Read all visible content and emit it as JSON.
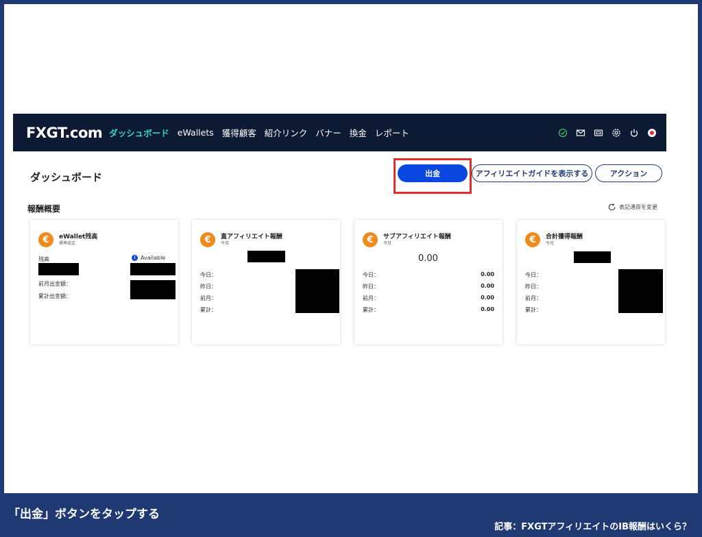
{
  "nav": {
    "logo": "FXGT.com",
    "items": [
      {
        "label": "ダッシュボード",
        "active": true
      },
      {
        "label": "eWallets",
        "active": false
      },
      {
        "label": "獲得顧客",
        "active": false
      },
      {
        "label": "紹介リンク",
        "active": false
      },
      {
        "label": "バナー",
        "active": false
      },
      {
        "label": "換金",
        "active": false
      },
      {
        "label": "レポート",
        "active": false
      }
    ],
    "icons": [
      "verified-icon",
      "mail-icon",
      "ticket-icon",
      "gear-icon",
      "power-icon",
      "flag-icon"
    ]
  },
  "page": {
    "title": "ダッシュボード",
    "withdraw_button": "出金",
    "guide_button": "アフィリエイトガイドを表示する",
    "action_button": "アクション",
    "section_title": "報酬概要",
    "change_display": "表記通貨を変更"
  },
  "cards": {
    "ewallet": {
      "title": "eWallet残高",
      "subtitle": "標準設定",
      "balance_label": "残高",
      "available": "Available",
      "last_month_withdrawal": "前月出金額：",
      "total_withdrawal": "累計出金額："
    },
    "direct": {
      "title": "直アフィリエイト報酬",
      "subtitle": "今月",
      "today": "今日：",
      "yesterday": "昨日：",
      "last_month": "前月：",
      "total": "累計："
    },
    "sub": {
      "title": "サブアフィリエイト報酬",
      "subtitle": "今月",
      "amount": "0.00",
      "today": "今日：",
      "yesterday": "昨日：",
      "last_month": "前月：",
      "total": "累計：",
      "today_val": "0.00",
      "yesterday_val": "0.00",
      "last_month_val": "0.00",
      "total_val": "0.00"
    },
    "total": {
      "title": "合計獲得報酬",
      "subtitle": "今月",
      "today": "今日：",
      "yesterday": "昨日：",
      "last_month": "前月：",
      "total": "累計："
    }
  },
  "footer": {
    "caption": "「出金」ボタンをタップする",
    "article": "記事：FXGTアフィリエイトのIB報酬はいくら？"
  },
  "colors": {
    "background": "#1f3a73",
    "nav": "#0c1b33",
    "accent": "#3fd0c9",
    "primary": "#0a47e0",
    "coin": "#ef8a1d",
    "highlight": "#e32d2d"
  }
}
